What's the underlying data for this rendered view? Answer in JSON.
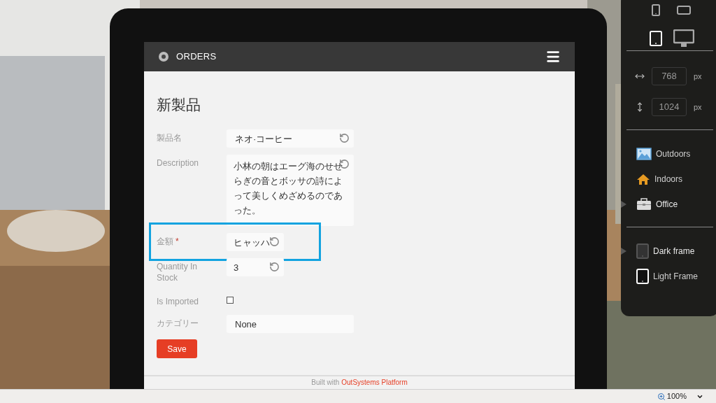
{
  "app_header": {
    "title": "ORDERS"
  },
  "page_title": "新製品",
  "form": {
    "fields": [
      {
        "kind": "text",
        "label": "製品名",
        "value": "ネオ·コーヒー"
      },
      {
        "kind": "textarea",
        "label": "Description",
        "value": "小林の朝はエーグ海のせせらぎの音とボッサの詩によって美しくめざめるのであった。"
      },
      {
        "kind": "short",
        "label": "金額",
        "required_mark": "*",
        "value": "ヒャッハ",
        "highlighted": true
      },
      {
        "kind": "short",
        "label": "Quantity In Stock",
        "value": "3",
        "highlighted": false
      },
      {
        "kind": "checkbox",
        "label": "Is Imported",
        "checked": false
      },
      {
        "kind": "select",
        "label": "カテゴリー",
        "value": "None"
      }
    ]
  },
  "save_button": "Save",
  "footer": {
    "text": "Built with",
    "link": "OutSystems Platform"
  },
  "device_panel": {
    "devices": [
      {
        "kind": "phone",
        "selected": false
      },
      {
        "kind": "phone_landscape",
        "selected": false
      },
      {
        "kind": "tablet",
        "selected": true
      },
      {
        "kind": "desktop",
        "selected": false
      }
    ],
    "width": {
      "value": "768",
      "unit": "px"
    },
    "height": {
      "value": "1024",
      "unit": "px"
    },
    "backgrounds": [
      {
        "kind": "outdoors",
        "label": "Outdoors",
        "selected": false
      },
      {
        "kind": "indoors",
        "label": "Indoors",
        "selected": false
      },
      {
        "kind": "office",
        "label": "Office",
        "selected": true
      }
    ],
    "frames": [
      {
        "kind": "dark",
        "label": "Dark frame",
        "selected": true
      },
      {
        "kind": "light",
        "label": "Light Frame",
        "selected": false
      }
    ]
  },
  "status_bar": {
    "zoom": "100%"
  }
}
